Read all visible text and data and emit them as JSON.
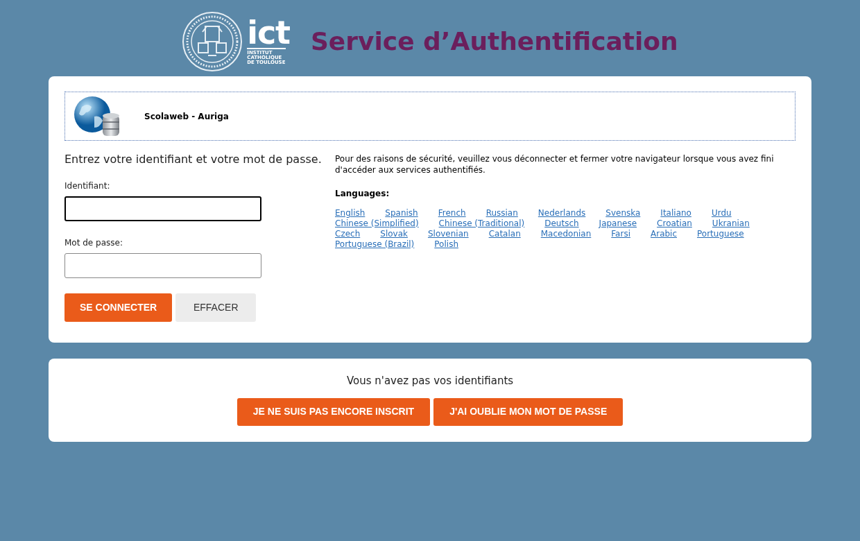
{
  "header": {
    "logo": {
      "word": "ict",
      "subtitle": [
        "INSTITUT",
        "CATHOLIQUE",
        "DE TOULOUSE"
      ]
    },
    "title": "Service d’Authentification"
  },
  "service": {
    "name": "Scolaweb - Auriga"
  },
  "login": {
    "heading": "Entrez votre identifiant et votre mot de passe.",
    "fields": [
      {
        "label": "Identifiant:",
        "focused": true
      },
      {
        "label": "Mot de passe:",
        "focused": false
      }
    ],
    "buttons": [
      {
        "label": "SE CONNECTER",
        "kind": "primary"
      },
      {
        "label": "EFFACER",
        "kind": "secondary"
      }
    ]
  },
  "info": {
    "notice": "Pour des raisons de sécurité, veuillez vous déconnecter et fermer votre navigateur lorsque vous avez fini d'accéder aux services authentifiés.",
    "languages_label": "Languages:",
    "language_rows": [
      [
        "English",
        "Spanish",
        "French",
        "Russian",
        "Nederlands",
        "Svenska",
        "Italiano",
        "Urdu"
      ],
      [
        "Chinese (Simplified)",
        "Chinese (Traditional)",
        "Deutsch",
        "Japanese",
        "Croatian",
        "Ukranian"
      ],
      [
        "Czech",
        "Slovak",
        "Slovenian",
        "Catalan",
        "Macedonian",
        "Farsi",
        "Arabic",
        "Portuguese"
      ],
      [
        "Portuguese (Brazil)",
        "Polish"
      ]
    ]
  },
  "help": {
    "heading": "Vous n'avez pas vos identifiants",
    "buttons": [
      "JE NE SUIS PAS ENCORE INSCRIT",
      "J'AI OUBLIE MON MOT DE PASSE"
    ]
  }
}
